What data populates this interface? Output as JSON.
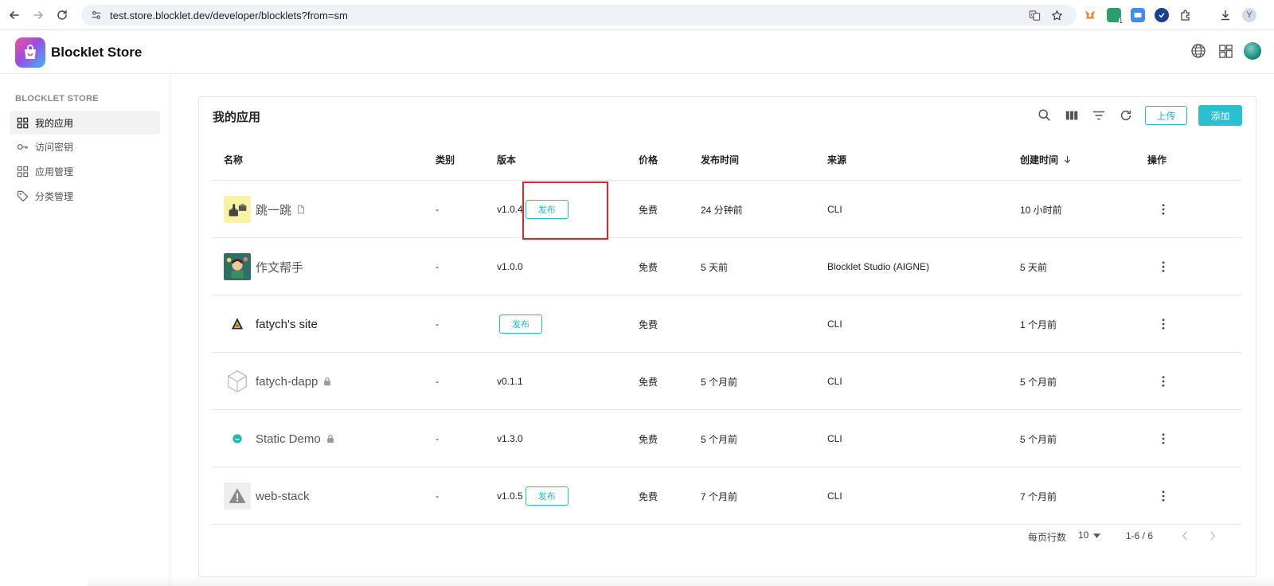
{
  "browser": {
    "url": "test.store.blocklet.dev/developer/blocklets?from=sm",
    "profile_initial": "Y",
    "ext_badge": "1"
  },
  "header": {
    "brand": "Blocklet Store"
  },
  "sidebar": {
    "section_title": "BLOCKLET STORE",
    "items": [
      {
        "label": "我的应用",
        "icon": "grid-icon",
        "active": true
      },
      {
        "label": "访问密钥",
        "icon": "key-icon",
        "active": false
      },
      {
        "label": "应用管理",
        "icon": "grid-icon",
        "active": false
      },
      {
        "label": "分类管理",
        "icon": "tag-icon",
        "active": false
      }
    ]
  },
  "main": {
    "title": "我的应用",
    "upload_label": "上传",
    "add_label": "添加",
    "columns": {
      "name": "名称",
      "category": "类别",
      "version": "版本",
      "price": "价格",
      "publish_time": "发布时间",
      "source": "来源",
      "created_time": "创建时间",
      "actions": "操作"
    },
    "publish_label": "发布",
    "rows": [
      {
        "name": "跳一跳",
        "category": "-",
        "version": "v1.0.4",
        "price": "免费",
        "publish_time": "24 分钟前",
        "source": "CLI",
        "created": "10 小时前"
      },
      {
        "name": "作文帮手",
        "category": "-",
        "version": "v1.0.0",
        "price": "免费",
        "publish_time": "5 天前",
        "source": "Blocklet Studio (AIGNE)",
        "created": "5 天前"
      },
      {
        "name": "fatych's site",
        "category": "-",
        "version": "",
        "price": "免费",
        "publish_time": "",
        "source": "CLI",
        "created": "1 个月前"
      },
      {
        "name": "fatych-dapp",
        "category": "-",
        "version": "v0.1.1",
        "price": "免费",
        "publish_time": "5 个月前",
        "source": "CLI",
        "created": "5 个月前"
      },
      {
        "name": "Static Demo",
        "category": "-",
        "version": "v1.3.0",
        "price": "免费",
        "publish_time": "5 个月前",
        "source": "CLI",
        "created": "5 个月前"
      },
      {
        "name": "web-stack",
        "category": "-",
        "version": "v1.0.5",
        "price": "免费",
        "publish_time": "7 个月前",
        "source": "CLI",
        "created": "7 个月前"
      }
    ],
    "pagination": {
      "rows_per_page_label": "每页行数",
      "rows_per_page": "10",
      "range": "1-6 / 6"
    }
  },
  "colors": {
    "accent": "#2bc0cf",
    "highlight": "#e0242c"
  }
}
